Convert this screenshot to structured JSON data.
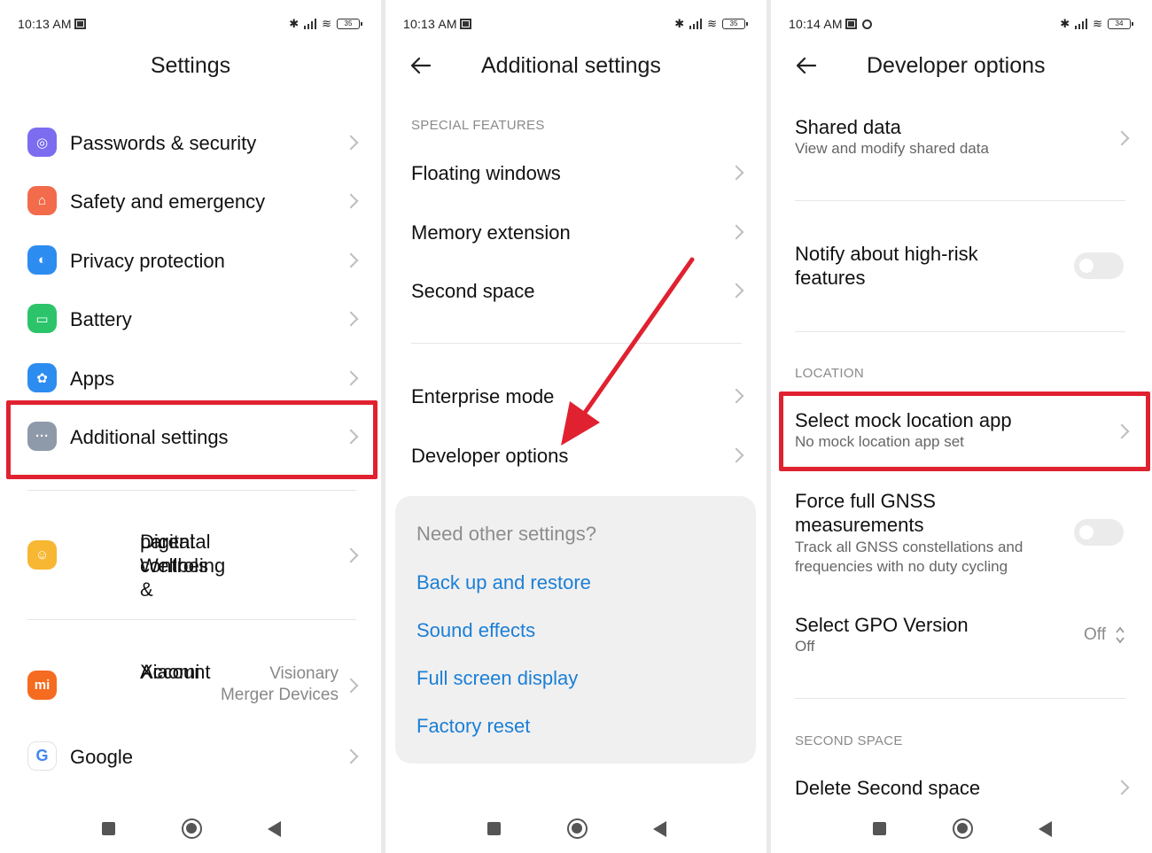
{
  "panels": [
    {
      "status": {
        "time": "10:13 AM",
        "battery": "35"
      },
      "title": "Settings",
      "items": [
        {
          "label": "Passwords & security",
          "icon": "fingerprint-icon",
          "color": "#7b6cf0"
        },
        {
          "label": "Safety and emergency",
          "icon": "emergency-icon",
          "color": "#f26b4b"
        },
        {
          "label": "Privacy protection",
          "icon": "privacy-icon",
          "color": "#2d8cf0"
        },
        {
          "label": "Battery",
          "icon": "battery-icon",
          "color": "#2bc46a"
        },
        {
          "label": "Apps",
          "icon": "gear-icon",
          "color": "#2d8cf0"
        },
        {
          "label": "Additional settings",
          "icon": "more-dots-icon",
          "color": "#8e9aaa"
        }
      ],
      "wellbeing": {
        "line1": "Digital Wellbeing &",
        "line2": "parental controls",
        "color": "#f7b733"
      },
      "account": {
        "line1": "Xiaomi",
        "line2": "Account",
        "value1": "Visionary",
        "value2": "Merger Devices",
        "color": "#f56b1f",
        "icon_text": "mi"
      },
      "google": {
        "label": "Google"
      }
    },
    {
      "status": {
        "time": "10:13 AM",
        "battery": "35"
      },
      "title": "Additional settings",
      "section": "SPECIAL FEATURES",
      "items": [
        "Floating windows",
        "Memory extension",
        "Second space"
      ],
      "items2": [
        "Enterprise mode",
        "Developer options"
      ],
      "card": {
        "question": "Need other settings?",
        "links": [
          "Back up and restore",
          "Sound effects",
          "Full screen display",
          "Factory reset"
        ]
      }
    },
    {
      "status": {
        "time": "10:14 AM",
        "battery": "34"
      },
      "title": "Developer options",
      "shared": {
        "label": "Shared data",
        "sub": "View and modify shared data"
      },
      "notify": {
        "line1": "Notify about high-risk",
        "line2": "features",
        "on": false
      },
      "section_location": "LOCATION",
      "mock": {
        "label": "Select mock location app",
        "sub": "No mock location app set"
      },
      "gnss": {
        "line1": "Force full GNSS",
        "line2": "measurements",
        "sub1": "Track all GNSS constellations and",
        "sub2": "frequencies with no duty cycling",
        "on": false
      },
      "gpo": {
        "label": "Select GPO Version",
        "sub": "Off",
        "value": "Off"
      },
      "section_second": "SECOND SPACE",
      "delete": {
        "label": "Delete Second space"
      }
    }
  ],
  "colors": {
    "highlight": "#e02130",
    "link": "#1b7fd6"
  }
}
